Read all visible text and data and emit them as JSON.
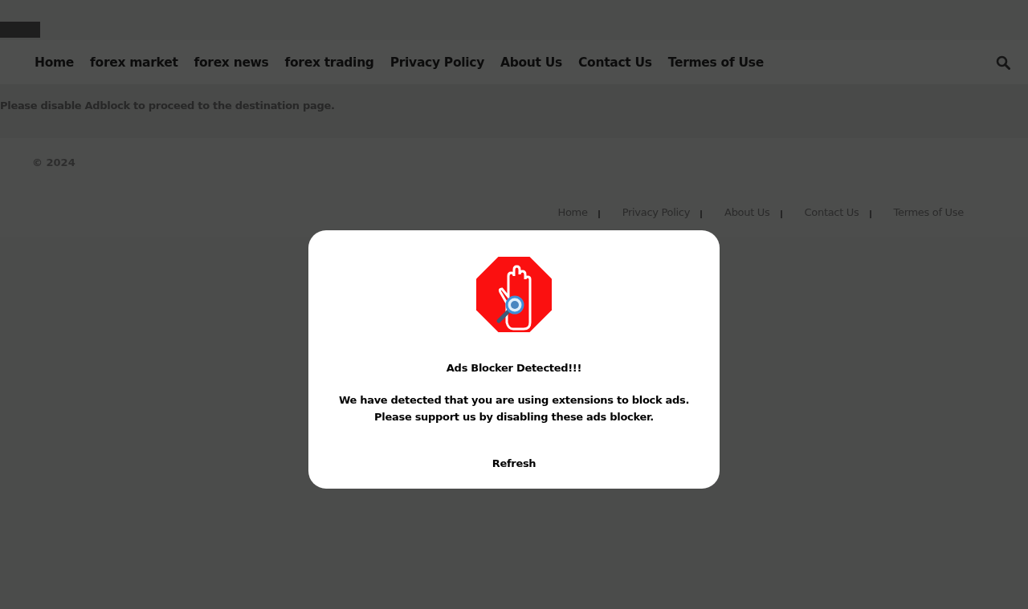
{
  "nav": {
    "items": [
      {
        "label": "Home"
      },
      {
        "label": "forex market"
      },
      {
        "label": "forex news"
      },
      {
        "label": "forex trading"
      },
      {
        "label": "Privacy Policy"
      },
      {
        "label": "About Us"
      },
      {
        "label": "Contact Us"
      },
      {
        "label": "Termes of Use"
      }
    ]
  },
  "content": {
    "message": "Please disable Adblock to proceed to the destination page."
  },
  "footer": {
    "copyright": "© 2024",
    "links": [
      {
        "label": "Home"
      },
      {
        "label": "Privacy Policy"
      },
      {
        "label": "About Us"
      },
      {
        "label": "Contact Us"
      },
      {
        "label": "Termes of Use"
      }
    ]
  },
  "modal": {
    "title": "Ads Blocker Detected!!!",
    "message_lines": [
      "We have detected that you are using extensions to block ads.",
      "Please support us by disabling these ads blocker."
    ],
    "button": "Refresh"
  }
}
